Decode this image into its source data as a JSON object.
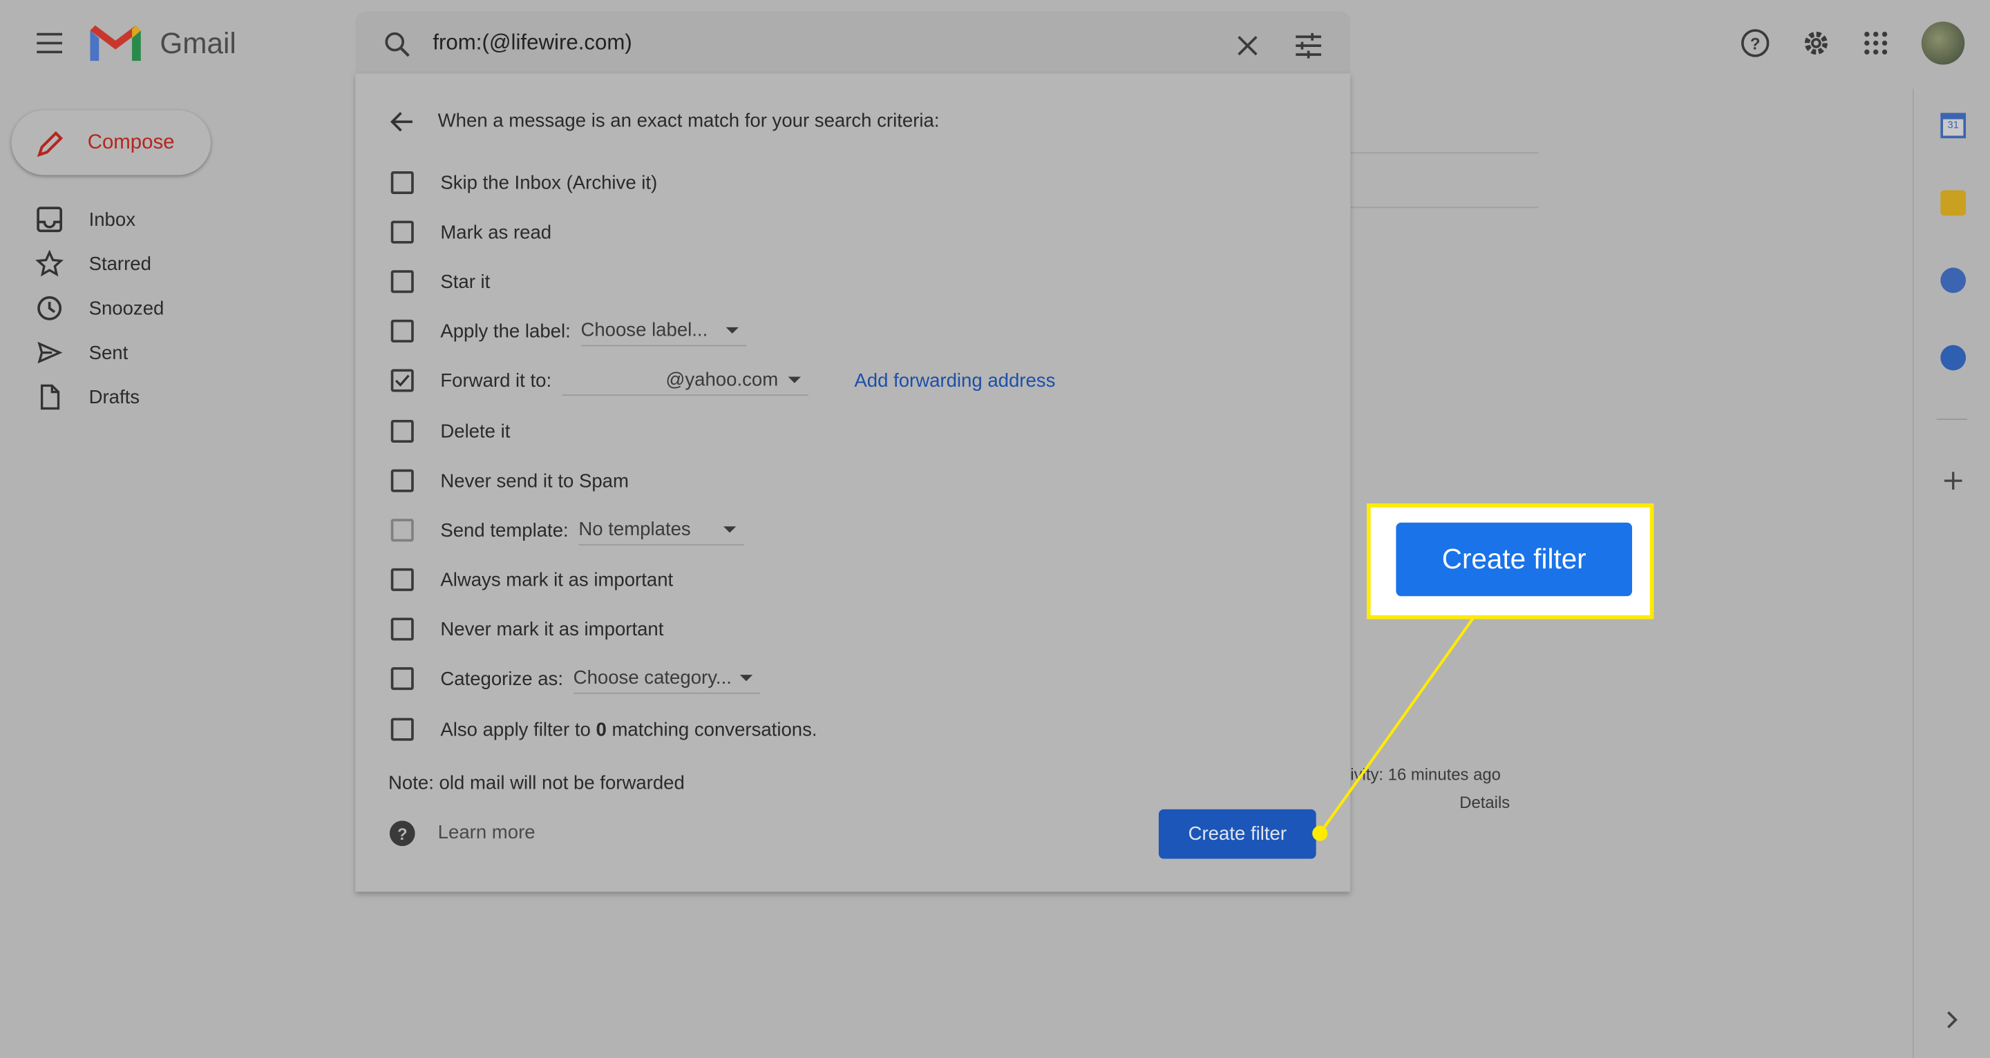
{
  "header": {
    "app_name": "Gmail",
    "search_value": "from:(@lifewire.com)"
  },
  "sidebar": {
    "compose_label": "Compose",
    "items": [
      {
        "label": "Inbox",
        "icon": "inbox-icon"
      },
      {
        "label": "Starred",
        "icon": "star-icon"
      },
      {
        "label": "Snoozed",
        "icon": "clock-icon"
      },
      {
        "label": "Sent",
        "icon": "send-icon"
      },
      {
        "label": "Drafts",
        "icon": "draft-icon"
      }
    ]
  },
  "filter": {
    "heading": "When a message is an exact match for your search criteria:",
    "options": [
      {
        "label": "Skip the Inbox (Archive it)",
        "checked": false
      },
      {
        "label": "Mark as read",
        "checked": false
      },
      {
        "label": "Star it",
        "checked": false
      },
      {
        "label": "Apply the label:",
        "checked": false,
        "select": "Choose label..."
      },
      {
        "label": "Forward it to:",
        "checked": true,
        "select": "@yahoo.com",
        "link": "Add forwarding address"
      },
      {
        "label": "Delete it",
        "checked": false
      },
      {
        "label": "Never send it to Spam",
        "checked": false
      },
      {
        "label": "Send template:",
        "checked": false,
        "disabled": true,
        "select": "No templates"
      },
      {
        "label": "Always mark it as important",
        "checked": false
      },
      {
        "label": "Never mark it as important",
        "checked": false
      },
      {
        "label": "Categorize as:",
        "checked": false,
        "select": "Choose category..."
      },
      {
        "label_pre": "Also apply filter to ",
        "label_bold": "0",
        "label_post": " matching conversations.",
        "checked": false
      }
    ],
    "note": "Note: old mail will not be forwarded",
    "learn_more": "Learn more",
    "create_label": "Create filter"
  },
  "background": {
    "activity": "ivity: 16 minutes ago",
    "details": "Details"
  },
  "callout": {
    "label": "Create filter",
    "color": "#ffeb00"
  },
  "colors": {
    "accent": "#1a73e8",
    "compose": "#b3261e"
  }
}
